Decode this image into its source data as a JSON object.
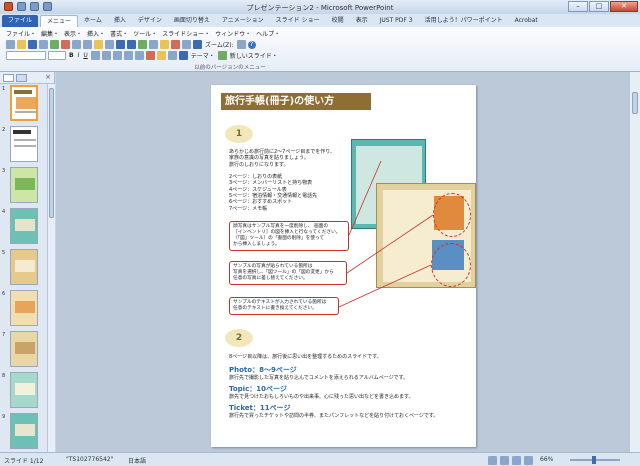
{
  "window": {
    "title": "プレゼンテーション2 - Microsoft PowerPoint",
    "min": "–",
    "max": "□",
    "close": "✕"
  },
  "tabs": [
    "ファイル",
    "メニュー",
    "ホーム",
    "挿入",
    "デザイン",
    "画面切り替え",
    "アニメーション",
    "スライド ショー",
    "校閲",
    "表示",
    "JUST PDF 3",
    "活用しよう！パワーポイント",
    "Acrobat"
  ],
  "menubar": [
    "ファイル・",
    "編集・",
    "表示・",
    "挿入・",
    "書式・",
    "ツール・",
    "スライドショー・",
    "ウィンドウ・",
    "ヘルプ・"
  ],
  "toolbar": {
    "zoom": "ズーム(Z):",
    "theme": "テーマ・",
    "new_slide": "新しいスライド・",
    "help": "?"
  },
  "ribbon_group_label": "以前のバージョンのメニュー",
  "slide": {
    "title": "旅行手帳(冊子)の使い方",
    "step1": "1",
    "step2": "2",
    "intro": "あらかじめ旅行前に2～7ページ目までを作り、\n家族の意識の写真を貼りましょう。\n旅行のしおりになります。\n\n2ページ：しおりの表紙\n3ページ：メンバーリストと持ち物表\n4ページ：スケジュール表\n5ページ：宿泊情報・交通情報と電話先\n6ページ：おすすめスポット\n7ページ：メモ帳",
    "callout1": "顔写真はサンプル写真を一度削除し、 画面の\n［インベントリ］の図を挿入と行なってください。\n（「図」ツール）の「書面の削除」を使って\nから挿入しましょう。",
    "callout2": "サンプルの写真が貼られている箇所は\n写真を選択し、「図ツール」の「図の変更」から\n任意の写真に差し替えてください。",
    "callout3": "サンプルのテキストが入力されている箇所は\n任意のテキストに書き換えてください。",
    "sec2_intro": "8ページ目以降は、旅行後に思い出を整理するためのスライドです。",
    "photo_title": "Photo：8～9ページ",
    "photo_desc": "旅行先で撮影した写真を貼り込んでコメントを添えられるアルバムページです。",
    "topic_title": "Topic：10ページ",
    "topic_desc": "旅先で見つけたおもしろいものや出来事、心に残った思い出などを書き込めます。",
    "ticket_title": "Ticket：11ページ",
    "ticket_desc": "旅行先で買ったチケットや訪問の半券、またパンフレットなどを貼り付けておくページです。"
  },
  "thumbs": [
    "1",
    "2",
    "3",
    "4",
    "5",
    "6",
    "7",
    "8",
    "9"
  ],
  "status": {
    "slide": "スライド 1/12",
    "theme": "\"TS102776542\"",
    "lang": "日本語",
    "zoom": "66%"
  }
}
